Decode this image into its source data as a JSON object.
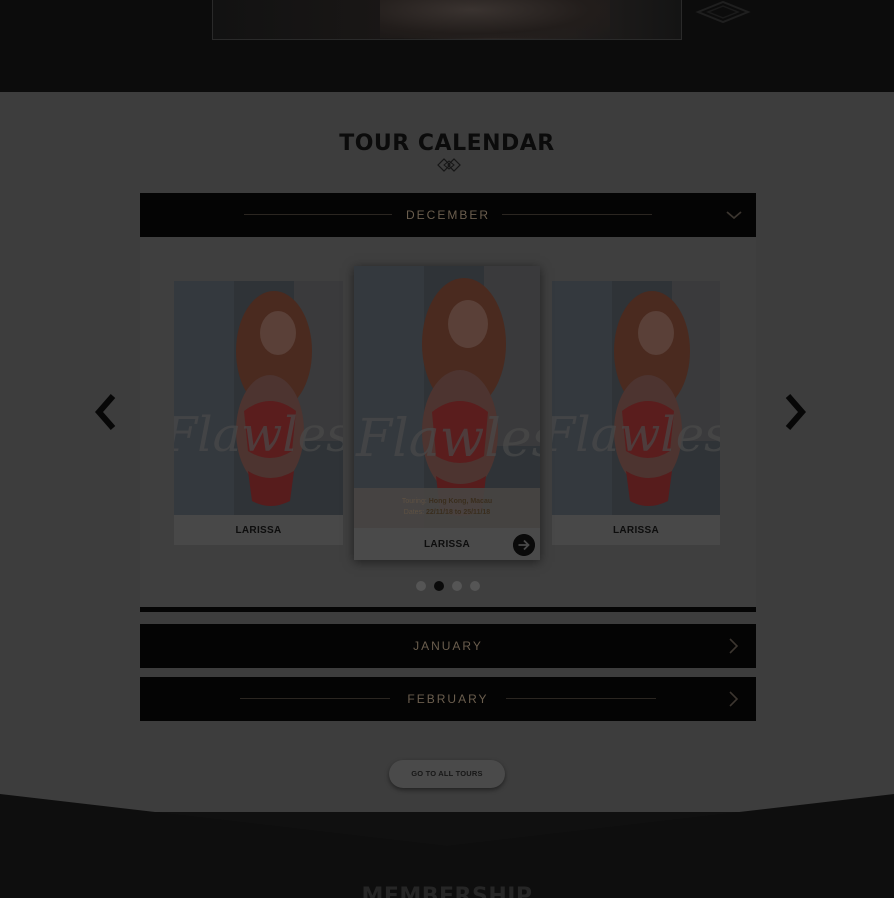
{
  "section": {
    "title": "TOUR CALENDAR"
  },
  "months": [
    {
      "label": "DECEMBER",
      "state": "expanded"
    },
    {
      "label": "JANUARY",
      "state": "collapsed"
    },
    {
      "label": "FEBRUARY",
      "state": "collapsed"
    }
  ],
  "carousel": {
    "cards": [
      {
        "name": "LARISSA",
        "watermark": "Flawless"
      },
      {
        "name": "LARISSA",
        "watermark": "Flawless",
        "touring_label": "Touring:",
        "touring_value": "Hong Kong, Macau",
        "dates_label": "Dates:",
        "dates_value": "22/11/18 to 25/11/18"
      },
      {
        "name": "LARISSA",
        "watermark": "Flawless"
      }
    ],
    "dots": {
      "count": 4,
      "active_index": 1
    }
  },
  "buttons": {
    "all_tours": "GO TO ALL TOURS"
  },
  "next_section": {
    "title": "MEMBERSHIP"
  },
  "icons": {
    "prev": "chevron-left-icon",
    "next": "chevron-right-icon",
    "month_expand": "chevron-down-icon",
    "month_collapse": "chevron-right-icon",
    "go": "arrow-right-circle-icon",
    "ornament": "diamond-ornament-icon"
  },
  "colors": {
    "overlay_bg": "#3d3d3d",
    "bar_bg": "#040404",
    "gold_text": "#6b5e4e",
    "dark": "#0a0a0a"
  }
}
